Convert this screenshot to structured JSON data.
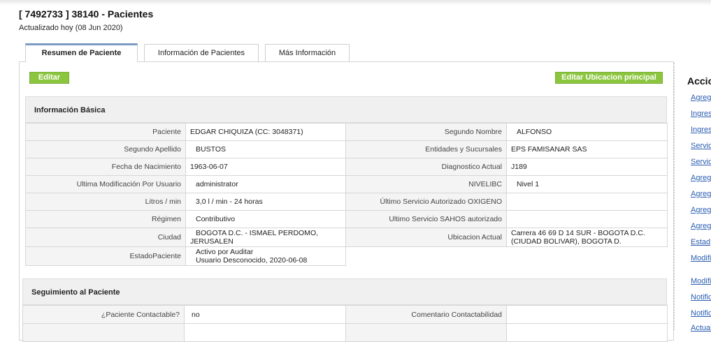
{
  "page": {
    "title": "[ 7492733 ] 38140 - Pacientes",
    "updated": "Actualizado hoy (08 Jun 2020)"
  },
  "tabs": [
    {
      "label": "Resumen de Paciente",
      "active": true
    },
    {
      "label": "Información de Pacientes",
      "active": false
    },
    {
      "label": "Más Información",
      "active": false
    }
  ],
  "buttons": {
    "edit": "Editar",
    "edit_location": "Editar Ubicacion principal"
  },
  "basic_info": {
    "title": "Información Básica",
    "rows": [
      {
        "l1": "Paciente",
        "v1": "EDGAR CHIQUIZA (CC: 3048371)",
        "l2": "Segundo Nombre",
        "v2": "ALFONSO"
      },
      {
        "l1": "Segundo Apellido",
        "v1": "BUSTOS",
        "l2": "Entidades y Sucursales",
        "v2": "EPS FAMISANAR SAS"
      },
      {
        "l1": "Fecha de Nacimiento",
        "v1": "1963-06-07",
        "l2": "Diagnostico Actual",
        "v2": "J189"
      },
      {
        "l1": "Ultima Modificación Por Usuario",
        "v1": "administrator",
        "l2": "NIVELIBC",
        "v2": "Nivel 1"
      },
      {
        "l1": "Litros / min",
        "v1": "3,0 l / min - 24 horas",
        "l2": "Último Servicio Autorizado OXIGENO",
        "v2": ""
      },
      {
        "l1": "Régimen",
        "v1": "Contributivo",
        "l2": "Ultimo Servicio SAHOS autorizado",
        "v2": ""
      },
      {
        "l1": "Ciudad",
        "v1": "BOGOTA D.C. - ISMAEL PERDOMO, JERUSALEN",
        "l2": "Ubicacion Actual",
        "v2": "Carrera 46 69 D 14 SUR - BOGOTA D.C. (CIUDAD BOLIVAR), BOGOTA D."
      },
      {
        "l1": "EstadoPaciente",
        "v1_line1": "Activo por Auditar",
        "v1_line2": "Usuario Desconocido, 2020-06-08"
      }
    ]
  },
  "follow_up": {
    "title": "Seguimiento al Paciente",
    "rows": [
      {
        "l1": "¿Paciente Contactable?",
        "v1": "no",
        "l2": "Comentario Contactabilidad",
        "v2": ""
      }
    ]
  },
  "actions": {
    "title": "Accio",
    "links": [
      "Agreg",
      "Ingres",
      "Ingres",
      "Servic",
      "Servic",
      "Agreg",
      "Agreg",
      "Agreg",
      "Agreg",
      "Estad",
      "Modifi",
      "Modifi",
      "Notific",
      "Notific",
      "Actual"
    ]
  }
}
